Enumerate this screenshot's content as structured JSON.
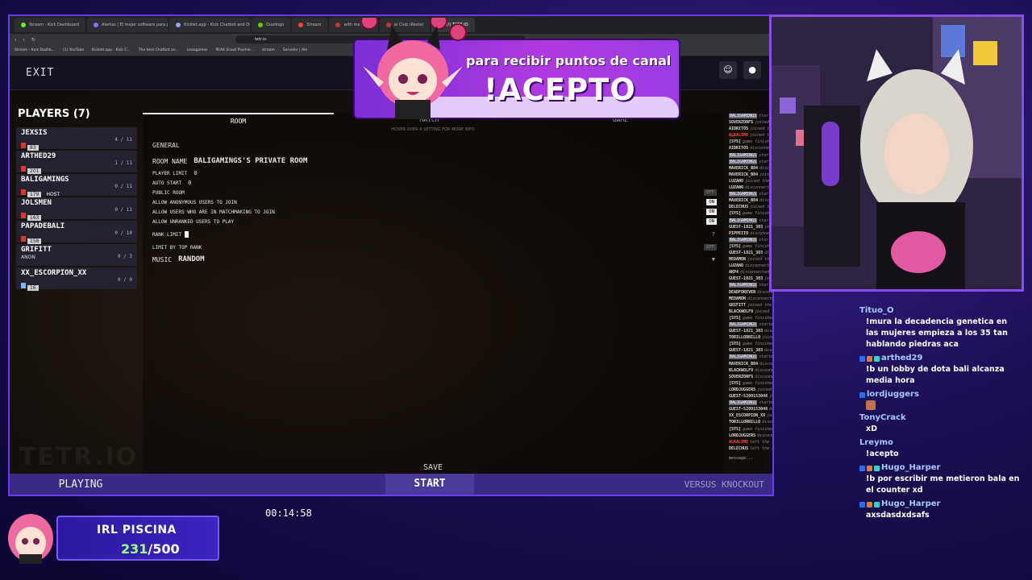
{
  "browser": {
    "tabs": [
      {
        "label": "Stream - Kick Dashboard",
        "color": "#53fc18"
      },
      {
        "label": "Alertas | El mejor software para pote",
        "color": "#8a6cff"
      },
      {
        "label": "Kicklet.app - Kick Chatbot and Over",
        "color": "#9a9aff"
      },
      {
        "label": "Duolingo",
        "color": "#58cc02"
      },
      {
        "label": "Stream",
        "color": "#ff3b3b"
      },
      {
        "label": "with me | Bali",
        "color": "#cc3333"
      },
      {
        "label": "al Club (Resto)",
        "color": "#cc3333"
      },
      {
        "label": "(!) TETR.IO",
        "color": "#9a6cff"
      }
    ],
    "url": "tetr.io",
    "bookmarks": [
      "Stream - Kick Dashb...",
      "(1) YouTube",
      "Kicklet.app - Kick C...",
      "The best Chatbot an...",
      "Lexogames",
      "PEAK Scout Plushie...",
      "stream",
      "Servidor | Ale"
    ]
  },
  "game": {
    "exit_label": "EXIT",
    "players_title": "PLAYERS (7)",
    "players": [
      {
        "name": "JEXSIS",
        "badge": "83",
        "flag": "pe",
        "score": "4 / 11",
        "host": ""
      },
      {
        "name": "ARTHED29",
        "badge": "201",
        "flag": "pe",
        "score": "1 / 11",
        "host": ""
      },
      {
        "name": "BALIGAMINGS",
        "badge": "179",
        "flag": "pe",
        "score": "0 / 11",
        "host": "HOST"
      },
      {
        "name": "JOLSMEN",
        "badge": "163",
        "flag": "pe",
        "score": "0 / 11",
        "host": ""
      },
      {
        "name": "PAPADEBALI",
        "badge": "158",
        "flag": "pe",
        "score": "0 / 10",
        "host": ""
      },
      {
        "name": "GRIFITT",
        "badge": "",
        "anon": "ANON",
        "flag": "",
        "score": "0 / 3",
        "host": ""
      },
      {
        "name": "XX_ESCORPION_XX",
        "badge": "16",
        "flag": "ar",
        "score": "0 / 0",
        "host": ""
      }
    ],
    "room_tabs": [
      "ROOM",
      "MATCH",
      "GAME"
    ],
    "room_hint": "HOVER OVER A SETTING FOR MORE INFO",
    "settings": {
      "section": "GENERAL",
      "room_name_label": "ROOM NAME",
      "room_name_value": "BALIGAMINGS'S PRIVATE ROOM",
      "player_limit_label": "PLAYER LIMIT",
      "player_limit_value": "0",
      "auto_start_label": "AUTO START",
      "auto_start_value": "0",
      "public_room_label": "PUBLIC ROOM",
      "public_room_state": "OFF",
      "anon_label": "ALLOW ANONYMOUS USERS TO JOIN",
      "anon_state": "ON",
      "matchmaking_label": "ALLOW USERS WHO ARE IN MATCHMAKING TO JOIN",
      "matchmaking_state": "ON",
      "unranked_label": "ALLOW UNRANKED USERS TO PLAY",
      "unranked_state": "ON",
      "rank_limit_label": "RANK LIMIT",
      "top_rank_label": "LIMIT BY TOP RANK",
      "top_rank_state": "OFF",
      "music_label": "MUSIC",
      "music_value": "RANDOM"
    },
    "save_label": "SAVE",
    "playing_label": "PLAYING",
    "start_label": "START",
    "mode_label": "VERSUS KNOCKOUT",
    "watermark": "TETR.IO",
    "chatlog_placeholder": "message...",
    "chatlog": [
      {
        "user": "BALIGAMINGS",
        "sys": true,
        "text": "started the game"
      },
      {
        "user": "SOVERZONFS",
        "sys": false,
        "text": "joined the room"
      },
      {
        "user": "AIDRITOS",
        "sys": false,
        "text": "joined the room"
      },
      {
        "user": "ALKALIME",
        "red": true,
        "text": "joined the room"
      },
      {
        "user": "[SYS]",
        "sys": false,
        "text": "game finished"
      },
      {
        "user": "AIDRITOS",
        "sys": false,
        "text": "disconnected"
      },
      {
        "user": "BALIGAMINGS",
        "sys": true,
        "text": "started the game"
      },
      {
        "user": "BALIGAMINGS",
        "sys": true,
        "text": "started the game"
      },
      {
        "user": "MAVERICK_B04",
        "sys": false,
        "text": "disconnected"
      },
      {
        "user": "MAVERICK_B04",
        "sys": false,
        "text": "joined the room"
      },
      {
        "user": "LUZANO",
        "sys": false,
        "text": "joined the room"
      },
      {
        "user": "LUZANO",
        "sys": false,
        "text": "disconnected"
      },
      {
        "user": "BALIGAMINGS",
        "sys": true,
        "text": "started the game"
      },
      {
        "user": "MAVERICK_B04",
        "sys": false,
        "text": "disconnected"
      },
      {
        "user": "DELECHUS",
        "sys": false,
        "text": "joined the room"
      },
      {
        "user": "[SYS]",
        "sys": false,
        "text": "game finished"
      },
      {
        "user": "BALIGAMINGS",
        "sys": true,
        "text": "started the game"
      },
      {
        "user": "GUEST-1821_303",
        "sys": false,
        "text": "joined the room"
      },
      {
        "user": "PIPPEITO",
        "sys": false,
        "text": "disconnected"
      },
      {
        "user": "BALIGAMINGS",
        "sys": true,
        "text": "started the game"
      },
      {
        "user": "[SYS]",
        "sys": false,
        "text": "game finished"
      },
      {
        "user": "GUEST-1821_303",
        "sys": false,
        "text": "disconnected"
      },
      {
        "user": "MEDAMON",
        "sys": false,
        "text": "joined the room"
      },
      {
        "user": "LUZANO",
        "sys": false,
        "text": "disconnected"
      },
      {
        "user": "AKP4",
        "sys": false,
        "text": "disconnected"
      },
      {
        "user": "GUEST-1821_303",
        "sys": false,
        "text": "joined the room"
      },
      {
        "user": "BALIGAMINGS",
        "sys": true,
        "text": "started the game"
      },
      {
        "user": "DEADFOREVER",
        "sys": false,
        "text": "disconnected"
      },
      {
        "user": "MEDAMON",
        "sys": false,
        "text": "disconnected"
      },
      {
        "user": "GRIFITT",
        "sys": false,
        "text": "joined the room"
      },
      {
        "user": "BLACKWOLF9",
        "sys": false,
        "text": "joined the room"
      },
      {
        "user": "[SYS]",
        "sys": false,
        "text": "game finished"
      },
      {
        "user": "BALIGAMINGS",
        "sys": true,
        "text": "started the game"
      },
      {
        "user": "GUEST-1821_303",
        "sys": false,
        "text": "disconnected"
      },
      {
        "user": "TORILLORNILLO",
        "sys": false,
        "text": "joined the room"
      },
      {
        "user": "[SYS]",
        "sys": false,
        "text": "game finished"
      },
      {
        "user": "GUEST-1821_303",
        "sys": false,
        "text": "disconnected"
      },
      {
        "user": "BALIGAMINGS",
        "sys": true,
        "text": "started the game"
      },
      {
        "user": "MAVERICK_B04",
        "sys": false,
        "text": "disconnected"
      },
      {
        "user": "BLACKWOLF9",
        "sys": false,
        "text": "disconnected"
      },
      {
        "user": "SOVERZONFS",
        "sys": false,
        "text": "disconnected"
      },
      {
        "user": "[SYS]",
        "sys": false,
        "text": "game finished"
      },
      {
        "user": "LORDJUGGERS",
        "sys": false,
        "text": "joined the room"
      },
      {
        "user": "GUEST-5209153048",
        "sys": false,
        "text": "joined the room"
      },
      {
        "user": "BALIGAMINGS",
        "sys": true,
        "text": "started the game"
      },
      {
        "user": "GUEST-5209153048",
        "sys": false,
        "text": "disconnected"
      },
      {
        "user": "XX_ESCORPION_XX",
        "sys": false,
        "text": "joined the room"
      },
      {
        "user": "TORILLORNILLO",
        "sys": false,
        "text": "disconnected"
      },
      {
        "user": "[SYS]",
        "sys": false,
        "text": "game finished"
      },
      {
        "user": "LORDJUGGERS",
        "sys": false,
        "text": "disconnected"
      },
      {
        "user": "ALKALIME",
        "red": true,
        "text": "left the room"
      },
      {
        "user": "DELECHUS",
        "sys": false,
        "text": "left the room"
      }
    ]
  },
  "banner": {
    "line1": "para recibir puntos de canal",
    "line2": "!ACEPTO"
  },
  "chat": [
    {
      "user": "Tituo_O",
      "badges": 0,
      "text": "!mura la decadencia genetica en las mujeres empieza a los 35 tan hablando piedras aca"
    },
    {
      "user": "arthed29",
      "badges": 3,
      "text": "!b un lobby de dota bali alcanza media hora"
    },
    {
      "user": "lordjuggers",
      "badges": 1,
      "text": ""
    },
    {
      "user": "TonyCrack",
      "badges": 0,
      "text": "xD"
    },
    {
      "user": "Lreymo",
      "badges": 0,
      "text": "!acepto"
    },
    {
      "user": "Hugo_Harper",
      "badges": 3,
      "text": "!b por escribir me metieron bala en el counter xd"
    },
    {
      "user": "Hugo_Harper",
      "badges": 3,
      "text": "axsdasdxdsafs"
    }
  ],
  "goal": {
    "title": "IRL PISCINA",
    "current": "231",
    "target": "/500"
  },
  "timer": "00:14:58",
  "colors": {
    "accent": "#6a3cf0",
    "goal_green": "#a6ff7a",
    "chat_user": "#a9c8ff"
  }
}
